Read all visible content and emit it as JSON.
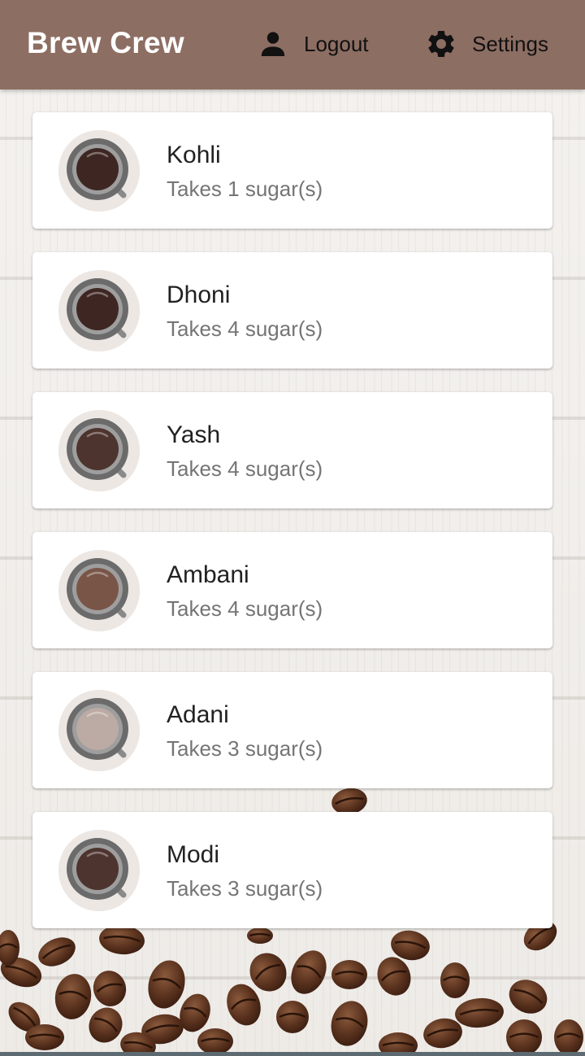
{
  "app_bar": {
    "title": "Brew Crew",
    "logout_label": "Logout",
    "settings_label": "Settings",
    "logout_icon": "person-icon",
    "settings_icon": "gear-icon",
    "background_color": "#8d6e63"
  },
  "brews": [
    {
      "name": "Kohli",
      "subtitle": "Takes 1 sugar(s)",
      "coffee_color": "#3e2723"
    },
    {
      "name": "Dhoni",
      "subtitle": "Takes 4 sugar(s)",
      "coffee_color": "#3e2723"
    },
    {
      "name": "Yash",
      "subtitle": "Takes 4 sugar(s)",
      "coffee_color": "#4e342e"
    },
    {
      "name": "Ambani",
      "subtitle": "Takes 4 sugar(s)",
      "coffee_color": "#795548"
    },
    {
      "name": "Adani",
      "subtitle": "Takes 3 sugar(s)",
      "coffee_color": "#bcaaa4"
    },
    {
      "name": "Modi",
      "subtitle": "Takes 3 sugar(s)",
      "coffee_color": "#4e342e"
    }
  ]
}
